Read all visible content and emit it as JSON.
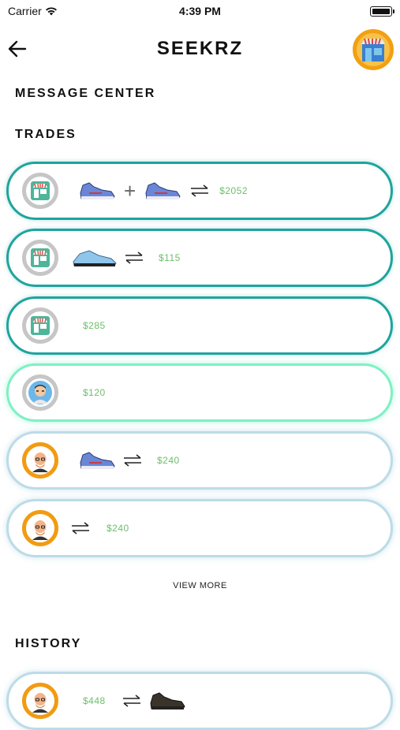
{
  "status": {
    "carrier": "Carrier",
    "time": "4:39 PM"
  },
  "header": {
    "logo": "SEEKRZ"
  },
  "sections": {
    "message_center": "MESSAGE CENTER",
    "trades": "TRADES",
    "history": "HISTORY"
  },
  "trades": [
    {
      "avatar": "store-avatar",
      "items": [
        "sneaker-blue",
        "sneaker-blue"
      ],
      "price": "$2052"
    },
    {
      "avatar": "store-avatar",
      "items": [
        "sneaker-light-blue"
      ],
      "price": "$115"
    },
    {
      "avatar": "store-avatar",
      "items": [],
      "price": "$285"
    },
    {
      "avatar": "person-avatar",
      "items": [],
      "price": "$120"
    },
    {
      "avatar": "bald-man-avatar",
      "items": [
        "sneaker-blue"
      ],
      "price": "$240"
    },
    {
      "avatar": "bald-man-avatar",
      "items": [],
      "price": "$240"
    }
  ],
  "view_more": "VIEW MORE",
  "history": [
    {
      "avatar": "bald-man-avatar",
      "price": "$448",
      "items": [
        "sneaker-black"
      ]
    }
  ],
  "colors": {
    "teal": "#1fa49c",
    "mint": "#7ff0c4",
    "light_blue": "#bcdbe7",
    "orange": "#f29b12",
    "price_green": "#6cbf6a"
  }
}
